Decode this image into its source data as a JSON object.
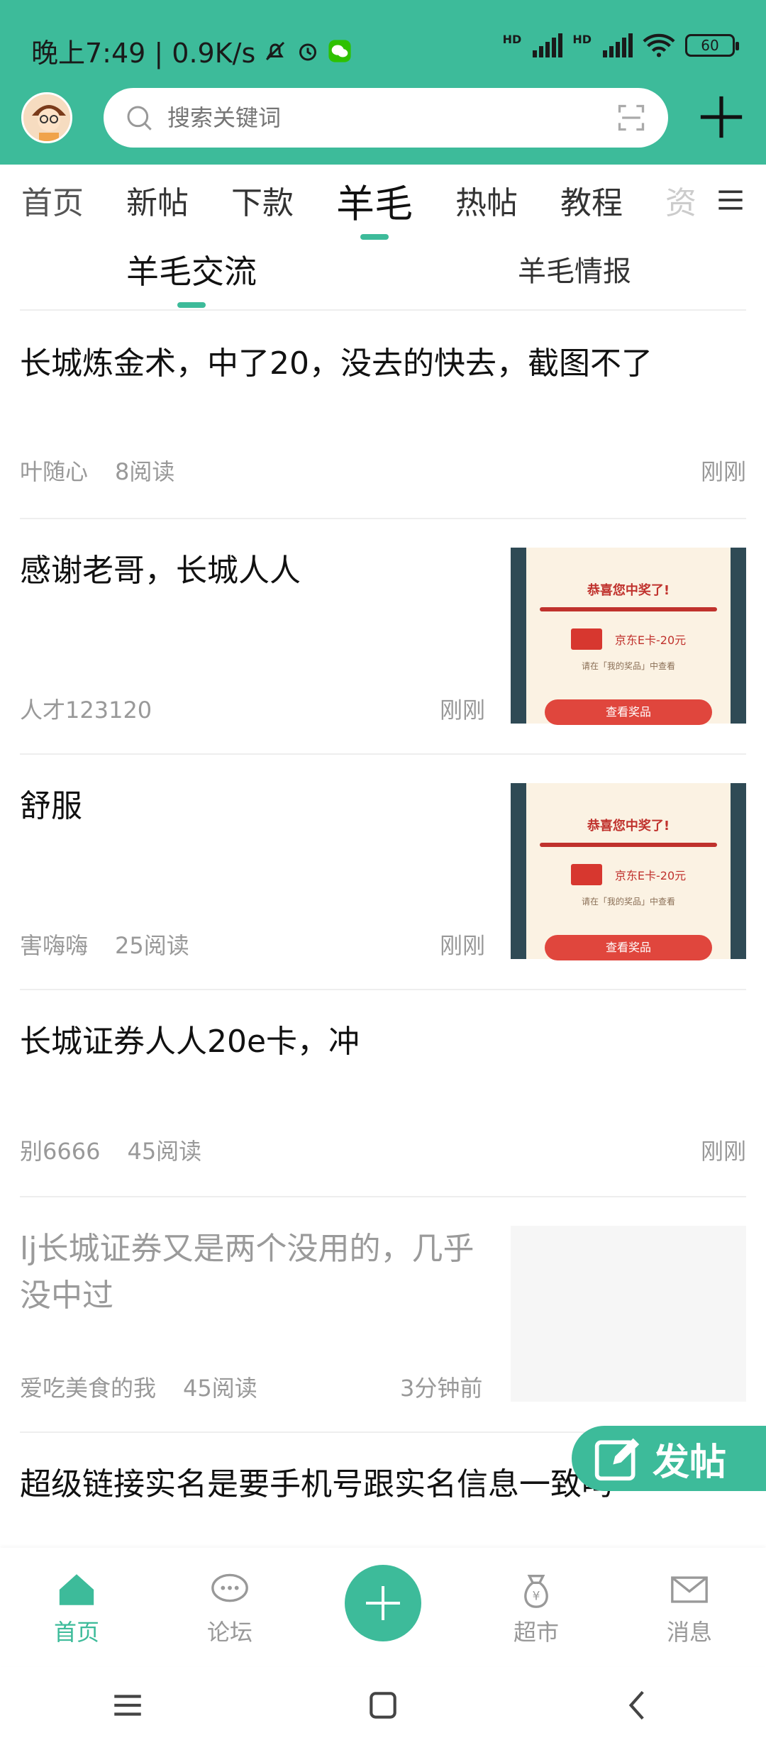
{
  "status_bar": {
    "time_and_speed": "晚上7:49 | 0.9K/s",
    "network_label": "HD",
    "battery": "60"
  },
  "search": {
    "placeholder": "搜索关键词"
  },
  "tabs": [
    "首页",
    "新帖",
    "下款",
    "羊毛",
    "热帖",
    "教程",
    "资"
  ],
  "subtabs": [
    "羊毛交流",
    "羊毛情报"
  ],
  "posts": [
    {
      "title": "长城炼金术，中了20，没去的快去，截图不了",
      "author": "叶随心",
      "reads": "8阅读",
      "time": "刚刚"
    },
    {
      "title": "感谢老哥，长城人人",
      "author": "人才123120",
      "reads": "",
      "time": "刚刚",
      "thumb": {
        "title": "恭喜您中奖了!",
        "card": "京东E卡-20元",
        "note": "请在「我的奖品」中查看",
        "button": "查看奖品"
      }
    },
    {
      "title": "舒服",
      "author": "害嗨嗨",
      "reads": "25阅读",
      "time": "刚刚",
      "thumb": {
        "title": "恭喜您中奖了!",
        "card": "京东E卡-20元",
        "note": "请在「我的奖品」中查看",
        "button": "查看奖品"
      }
    },
    {
      "title": "长城证券人人20e卡，冲",
      "author": "别6666",
      "reads": "45阅读",
      "time": "刚刚"
    },
    {
      "title": "lj长城证券又是两个没用的，几乎没中过",
      "author": "爱吃美食的我",
      "reads": "45阅读",
      "time": "3分钟前"
    },
    {
      "title": "超级链接实名是要手机号跟实名信息一致吗"
    }
  ],
  "fab": {
    "label": "发帖"
  },
  "bottom_nav": [
    "首页",
    "论坛",
    "超市",
    "消息"
  ],
  "colors": {
    "accent": "#3dbb9a"
  }
}
